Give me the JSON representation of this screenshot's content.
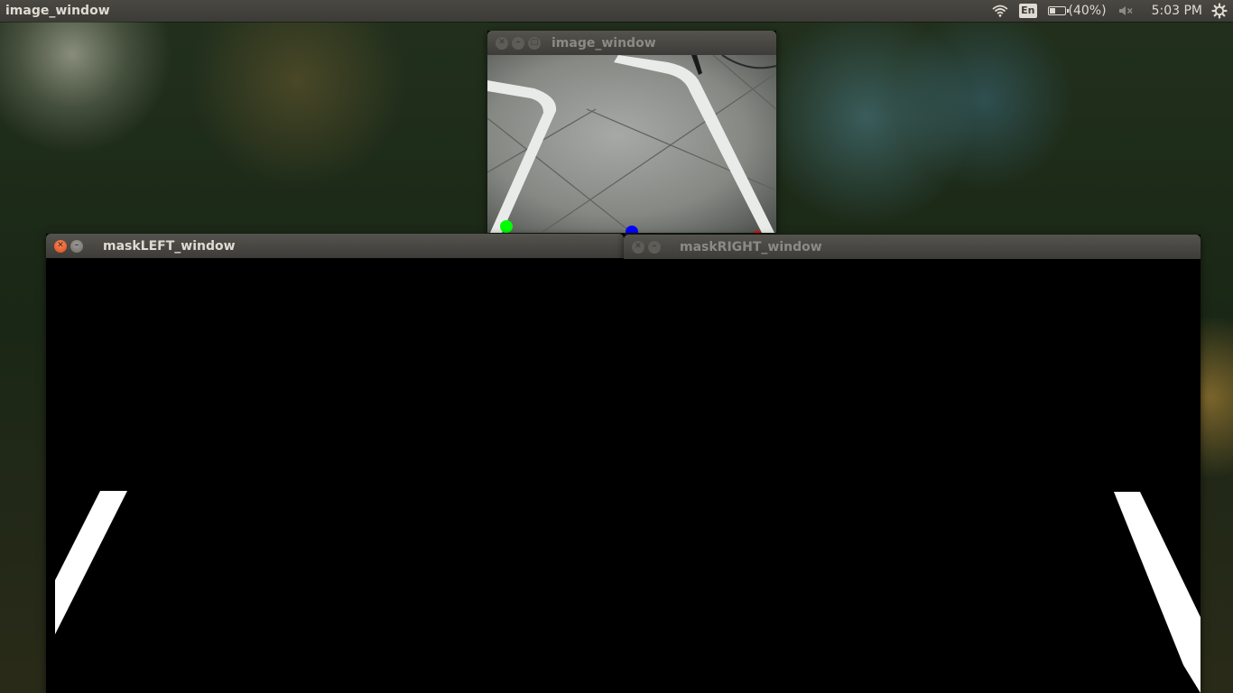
{
  "panel": {
    "app_title": "image_window",
    "keyboard_layout": "En",
    "battery_text": "(40%)",
    "battery_level": 0.4,
    "clock": "5:03 PM",
    "icons": [
      "wifi-icon",
      "keyboard-layout-icon",
      "battery-icon",
      "volume-muted-icon",
      "settings-gear-icon"
    ]
  },
  "windows": {
    "image": {
      "title": "image_window"
    },
    "mask_left": {
      "title": "maskLEFT_window"
    },
    "mask_right": {
      "title": "maskRIGHT_window"
    }
  },
  "colors": {
    "panel_bg": "#3c3b37",
    "close_active": "#de4815",
    "marker_left": "#00ff00",
    "marker_center": "#0000ff",
    "marker_right": "#ff0000"
  },
  "markers": [
    "left-lane-marker",
    "center-marker",
    "right-lane-marker"
  ]
}
